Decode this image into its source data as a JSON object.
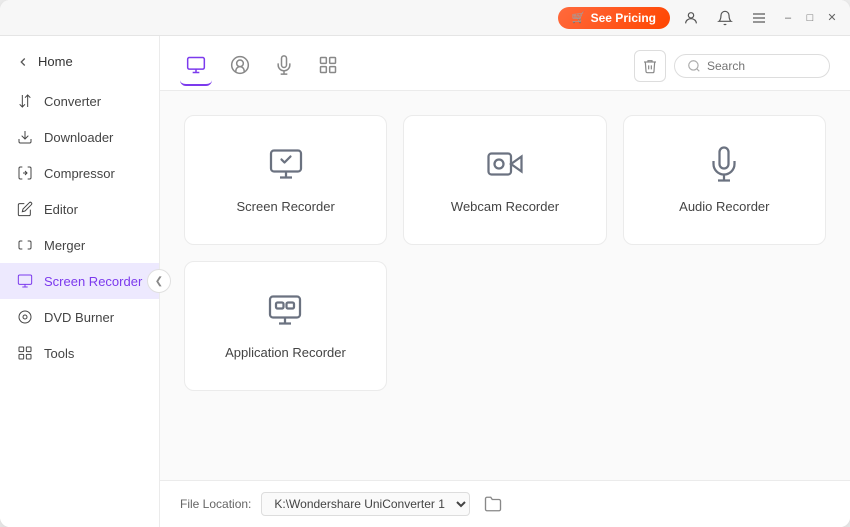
{
  "titlebar": {
    "see_pricing_label": "See Pricing",
    "cart_icon": "🛒"
  },
  "sidebar": {
    "home_label": "Home",
    "items": [
      {
        "id": "converter",
        "label": "Converter",
        "active": false
      },
      {
        "id": "downloader",
        "label": "Downloader",
        "active": false
      },
      {
        "id": "compressor",
        "label": "Compressor",
        "active": false
      },
      {
        "id": "editor",
        "label": "Editor",
        "active": false
      },
      {
        "id": "merger",
        "label": "Merger",
        "active": false
      },
      {
        "id": "screen-recorder",
        "label": "Screen Recorder",
        "active": true
      },
      {
        "id": "dvd-burner",
        "label": "DVD Burner",
        "active": false
      },
      {
        "id": "tools",
        "label": "Tools",
        "active": false
      }
    ]
  },
  "toolbar": {
    "search_placeholder": "Search"
  },
  "recorders": {
    "row1": [
      {
        "id": "screen-recorder",
        "label": "Screen Recorder"
      },
      {
        "id": "webcam-recorder",
        "label": "Webcam Recorder"
      },
      {
        "id": "audio-recorder",
        "label": "Audio Recorder"
      }
    ],
    "row2": [
      {
        "id": "application-recorder",
        "label": "Application Recorder"
      }
    ]
  },
  "footer": {
    "file_location_label": "File Location:",
    "file_location_value": "K:\\Wondershare UniConverter 1",
    "file_location_options": [
      "K:\\Wondershare UniConverter 1"
    ]
  }
}
